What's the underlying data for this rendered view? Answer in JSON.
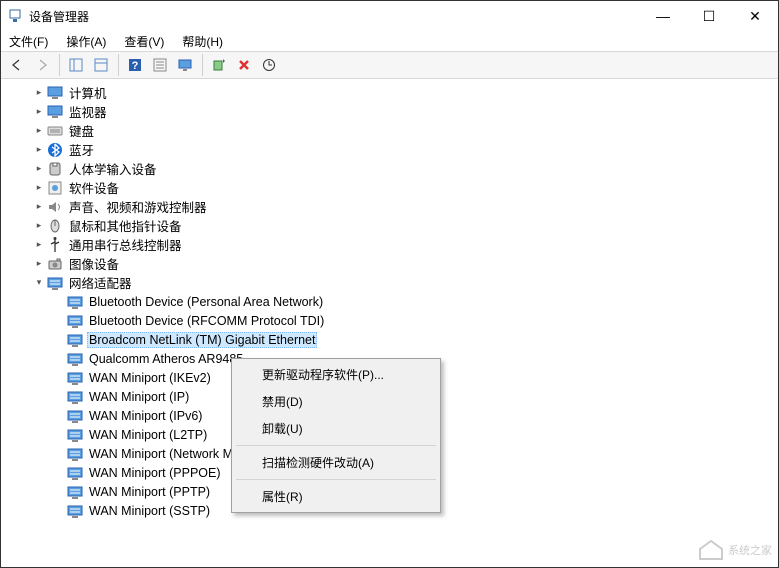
{
  "window": {
    "title": "设备管理器",
    "min": "—",
    "max": "☐",
    "close": "✕"
  },
  "menu": {
    "file": "文件(F)",
    "action": "操作(A)",
    "view": "查看(V)",
    "help": "帮助(H)"
  },
  "toolbar_icons": [
    "back-arrow",
    "forward-arrow",
    "sep",
    "show-tree-icon",
    "properties-icon",
    "sep",
    "help-icon",
    "details-icon",
    "monitor-icon",
    "sep",
    "devices-icon",
    "remove-icon",
    "update-icon"
  ],
  "tree": {
    "categories": [
      {
        "id": "computer",
        "label": "计算机",
        "icon": "monitor",
        "expanded": false
      },
      {
        "id": "monitor",
        "label": "监视器",
        "icon": "monitor",
        "expanded": false
      },
      {
        "id": "keyboard",
        "label": "键盘",
        "icon": "keyboard",
        "expanded": false
      },
      {
        "id": "bluetooth",
        "label": "蓝牙",
        "icon": "bt",
        "expanded": false
      },
      {
        "id": "hid",
        "label": "人体学输入设备",
        "icon": "hid",
        "expanded": false
      },
      {
        "id": "software",
        "label": "软件设备",
        "icon": "software",
        "expanded": false
      },
      {
        "id": "audio",
        "label": "声音、视频和游戏控制器",
        "icon": "speaker",
        "expanded": false
      },
      {
        "id": "mouse",
        "label": "鼠标和其他指针设备",
        "icon": "mouse",
        "expanded": false
      },
      {
        "id": "usb",
        "label": "通用串行总线控制器",
        "icon": "usb",
        "expanded": false
      },
      {
        "id": "imaging",
        "label": "图像设备",
        "icon": "camera",
        "expanded": false
      },
      {
        "id": "network",
        "label": "网络适配器",
        "icon": "net",
        "expanded": true
      }
    ],
    "network_children": [
      {
        "label": "Bluetooth Device (Personal Area Network)",
        "selected": false
      },
      {
        "label": "Bluetooth Device (RFCOMM Protocol TDI)",
        "selected": false
      },
      {
        "label": "Broadcom NetLink (TM) Gigabit Ethernet",
        "selected": true
      },
      {
        "label": "Qualcomm Atheros AR9485",
        "selected": false,
        "truncated": true
      },
      {
        "label": "WAN Miniport (IKEv2)",
        "selected": false
      },
      {
        "label": "WAN Miniport (IP)",
        "selected": false
      },
      {
        "label": "WAN Miniport (IPv6)",
        "selected": false
      },
      {
        "label": "WAN Miniport (L2TP)",
        "selected": false
      },
      {
        "label": "WAN Miniport (Network Mo",
        "selected": false,
        "truncated": true
      },
      {
        "label": "WAN Miniport (PPPOE)",
        "selected": false
      },
      {
        "label": "WAN Miniport (PPTP)",
        "selected": false
      },
      {
        "label": "WAN Miniport (SSTP)",
        "selected": false
      }
    ]
  },
  "context_menu": {
    "items": [
      {
        "label": "更新驱动程序软件(P)...",
        "sep_after": false
      },
      {
        "label": "禁用(D)",
        "sep_after": false
      },
      {
        "label": "卸载(U)",
        "sep_after": true
      },
      {
        "label": "扫描检测硬件改动(A)",
        "sep_after": true
      },
      {
        "label": "属性(R)",
        "sep_after": false
      }
    ]
  },
  "watermark": "系统之家"
}
